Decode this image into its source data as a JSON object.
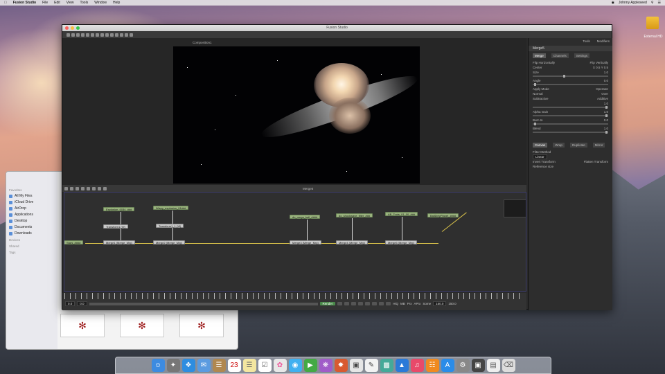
{
  "menubar": {
    "app": "Fusion Studio",
    "items": [
      "File",
      "Edit",
      "View",
      "Tools",
      "Window",
      "Help"
    ],
    "user": "Johnny Appleseed"
  },
  "desktop": {
    "drive_label": "External HD"
  },
  "finder": {
    "sections": {
      "favorites": "Favorites",
      "devices": "Devices",
      "shared": "Shared",
      "tags": "Tags"
    },
    "items": [
      "All My Files",
      "iCloud Drive",
      "AirDrop",
      "Applications",
      "Desktop",
      "Documents",
      "Downloads"
    ]
  },
  "window": {
    "title": "Fusion Studio",
    "viewer_label": "Composition1",
    "flow_label": "Merge5"
  },
  "inspector": {
    "tabs": [
      "Tools",
      "Modifiers"
    ],
    "node_name": "Merge5",
    "sub_tabs": [
      "Merge",
      "Channels",
      "Settings"
    ],
    "rows": [
      {
        "label": "Flip Horizontally",
        "value": "Flip Vertically"
      },
      {
        "label": "Center",
        "value": "X 0.5   Y 0.5"
      },
      {
        "label": "Size",
        "value": "1.0"
      },
      {
        "label": "Angle",
        "value": "0.0"
      },
      {
        "label": "Apply Mode",
        "value": "Operator"
      },
      {
        "label": "Normal",
        "value": "Over"
      },
      {
        "label": "Subtractive",
        "value": "Additive"
      },
      {
        "label": "",
        "value": "1.0"
      },
      {
        "label": "Alpha Gain",
        "value": "1.0"
      },
      {
        "label": "Burn In",
        "value": "0.0"
      },
      {
        "label": "Blend",
        "value": "1.0"
      }
    ],
    "bottom_tabs": [
      "Canvas",
      "Wrap",
      "Duplicate",
      "Mirror"
    ],
    "filter_method": "Filter Method",
    "filter_value": "Linear",
    "invert_transform": "Invert Transform",
    "flatten_transform": "Flatten Transform",
    "reference_size": "Reference size"
  },
  "flow": {
    "tools": [
      {
        "id": "t1",
        "label": "Explosion_0034_###"
      },
      {
        "id": "t2",
        "label": "Wispy_explosion_01###"
      },
      {
        "id": "t3",
        "label": "do_mega_ball_####"
      },
      {
        "id": "t4",
        "label": "do_shockwave_filter_###"
      },
      {
        "id": "t5",
        "label": "AB_Tools_01_00_###"
      },
      {
        "id": "t6",
        "label": "BallDirtyPlanet_####"
      },
      {
        "id": "t0",
        "label": "Stars_####"
      }
    ],
    "transforms": [
      {
        "id": "x1",
        "label": "Transform1 (Xf)"
      },
      {
        "id": "x2",
        "label": "Transform1_1 (Xf)"
      }
    ],
    "merges": [
      {
        "id": "m1",
        "label": "Merge1 (Merge_Mrg)"
      },
      {
        "id": "m2",
        "label": "Merge2 (Merge_Mrg)"
      },
      {
        "id": "m3",
        "label": "Merge3 (Merge_Mrg)"
      },
      {
        "id": "m4",
        "label": "Merge4 (Merge_Mrg)"
      },
      {
        "id": "m5",
        "label": "Merge5 (Merge_Mrg)"
      }
    ]
  },
  "timeline": {
    "start": "0.0",
    "current": "0.0",
    "end": "150.0",
    "render_label": "Render",
    "hiq": "HiQ",
    "mb": "MB",
    "prx": "Prx",
    "aprx": "APrx",
    "some": "Some",
    "frame": "150.0"
  },
  "dock_apps": [
    "Finder",
    "Launchpad",
    "Safari",
    "Mail",
    "Contacts",
    "Calendar",
    "Notes",
    "Reminders",
    "Photos",
    "Messages",
    "FaceTime",
    "Fusion",
    "DaVinci",
    "Preview",
    "TextEdit",
    "Numbers",
    "Keynote",
    "iTunes",
    "iBooks",
    "App Store",
    "System Preferences",
    "Fusion Studio",
    "Documents",
    "Trash"
  ]
}
